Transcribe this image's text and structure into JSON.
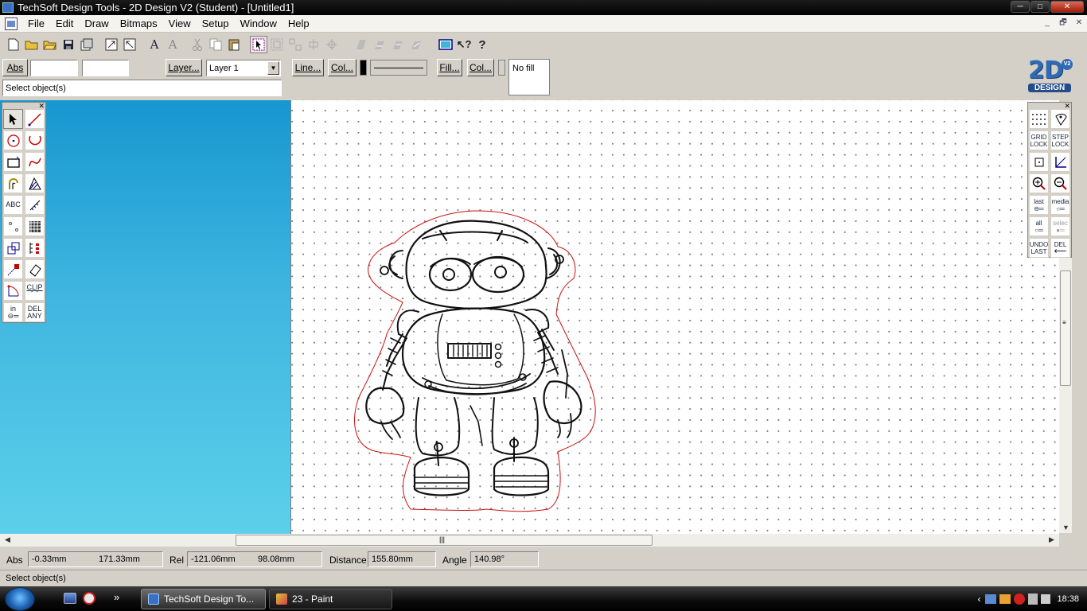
{
  "window": {
    "title": "TechSoft Design Tools - 2D Design V2 (Student) - [Untitled1]",
    "min": "─",
    "max": "□",
    "close": "✕"
  },
  "menu": {
    "items": [
      "File",
      "Edit",
      "Draw",
      "Bitmaps",
      "View",
      "Setup",
      "Window",
      "Help"
    ],
    "mdi_min": "_",
    "mdi_restore": "🗗",
    "mdi_close": "✕"
  },
  "props": {
    "abs_label": "Abs",
    "abs_x": "",
    "abs_y": "",
    "layer_button": "Layer...",
    "layer_value": "Layer 1",
    "line_button": "Line...",
    "line_col_button": "Col...",
    "fill_button": "Fill...",
    "fill_col_button": "Col...",
    "fill_value": "No fill",
    "prompt": "Select object(s)"
  },
  "logo": {
    "big": "2D",
    "small": "DESIGN",
    "badge": "V2"
  },
  "left_palette": {
    "text_tool": "ABC",
    "clip_tool": "CLIP",
    "in_tool": "in",
    "del_any_1": "DEL",
    "del_any_2": "ANY"
  },
  "right_palette": {
    "grid_lock_1": "GRID",
    "grid_lock_2": "LOCK",
    "step_lock_1": "STEP",
    "step_lock_2": "LOCK",
    "zoom_last": "last",
    "zoom_media": "media",
    "zoom_all": "all",
    "zoom_selec": "selec",
    "undo_1": "UNDO",
    "undo_2": "LAST",
    "del_1": "DEL",
    "del_2": "⟵"
  },
  "status": {
    "abs_label": "Abs",
    "abs_x": "-0.33mm",
    "abs_y": "171.33mm",
    "rel_label": "Rel",
    "rel_x": "-121.06mm",
    "rel_y": "98.08mm",
    "distance_label": "Distance",
    "distance": "155.80mm",
    "angle_label": "Angle",
    "angle": "140.98°",
    "prompt": "Select object(s)"
  },
  "taskbar": {
    "tasks": [
      "TechSoft Design To...",
      "23 - Paint"
    ],
    "more": "»",
    "clock": "18:38"
  },
  "colors": {
    "canvas_bg": "#ffffff",
    "left_panel_top": "#1797d0",
    "left_panel_bottom": "#5cd0ea",
    "cut_outline": "#cc1010"
  }
}
